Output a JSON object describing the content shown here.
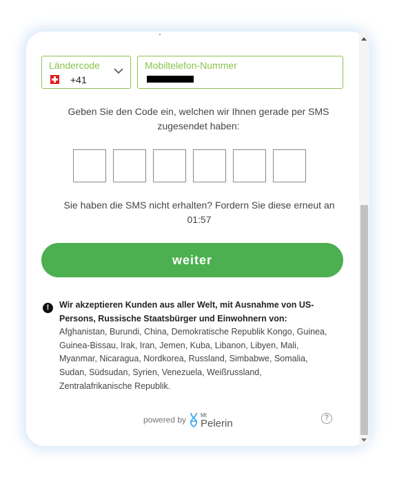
{
  "form": {
    "country_label": "Ländercode",
    "country_flag": "swiss-flag",
    "country_code": "+41",
    "phone_label": "Mobiltelefon-Nummer",
    "phone_value_masked": true
  },
  "instruction": "Geben Sie den Code ein, welchen wir Ihnen gerade per SMS zugesendet haben:",
  "code_inputs": [
    "",
    "",
    "",
    "",
    "",
    ""
  ],
  "resend": {
    "text": "Sie haben die SMS nicht erhalten? Fordern Sie diese erneut an",
    "countdown": "01:57"
  },
  "submit_label": "weiter",
  "notice": {
    "bold": "Wir akzeptieren Kunden aus aller Welt, mit Ausnahme von US-Persons, Russische Staatsbürger und Einwohnern von:",
    "text": "Afghanistan, Burundi, China, Demokratische Republik Kongo, Guinea, Guinea-Bissau, Irak, Iran, Jemen, Kuba, Libanon, Libyen, Mali, Myanmar, Nicaragua, Nordkorea, Russland, Simbabwe, Somalia, Sudan, Südsudan, Syrien, Venezuela, Weißrussland, Zentralafrikanische Republik."
  },
  "footer": {
    "powered_by": "powered by",
    "logo_small": "Mt",
    "logo_name": "Pelerin"
  },
  "colors": {
    "accent_green": "#8bc34a",
    "button_green": "#4caf50"
  }
}
